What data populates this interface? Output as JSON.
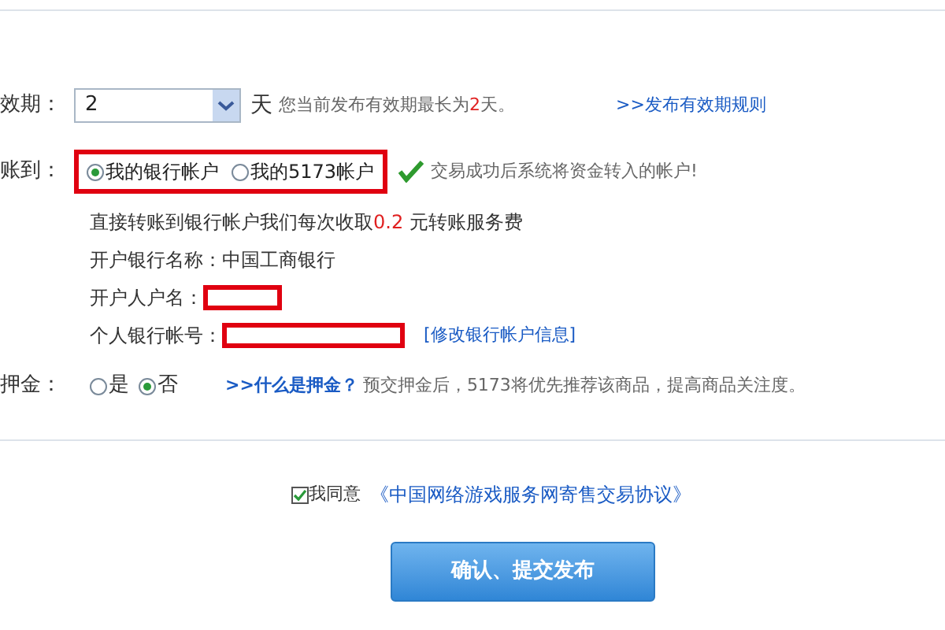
{
  "validity": {
    "label": "效期：",
    "select_value": "2",
    "unit": "天",
    "note": [
      {
        "text": "您当前发布有效期最长为",
        "kind": "plain"
      },
      {
        "text": "2",
        "kind": "red"
      },
      {
        "text": "天。",
        "kind": "plain"
      }
    ],
    "link": ">>发布有效期规则"
  },
  "payout": {
    "label": "账到：",
    "options": [
      {
        "label": "我的银行帐户",
        "selected": true
      },
      {
        "label": "我的5173帐户",
        "selected": false
      }
    ],
    "note": "交易成功后系统将资金转入的帐户!"
  },
  "bank_info": {
    "fee": [
      {
        "text": "直接转账到银行帐户我们每次收取",
        "kind": "plain"
      },
      {
        "text": "0.2",
        "kind": "red"
      },
      {
        "text": " 元转账服务费",
        "kind": "plain"
      }
    ],
    "bank_name": "开户银行名称：中国工商银行",
    "holder_label": "开户人户名：",
    "account_label": "个人银行帐号：",
    "edit_link": "[修改银行帐户信息]"
  },
  "deposit": {
    "label": "押金：",
    "options": [
      {
        "label": "是",
        "selected": false
      },
      {
        "label": "否",
        "selected": true
      }
    ],
    "link": ">>什么是押金？",
    "note": "预交押金后，5173将优先推荐该商品，提高商品关注度。"
  },
  "agreement": {
    "checked": true,
    "label": "我同意",
    "link": "《中国网络游戏服务网寄售交易协议》"
  },
  "submit": "确认、提交发布"
}
